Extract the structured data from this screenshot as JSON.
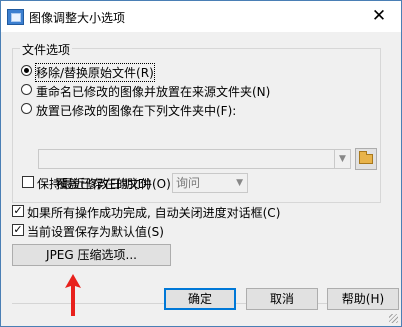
{
  "window": {
    "title": "图像调整大小选项",
    "close_glyph": "✕"
  },
  "file_options": {
    "legend": "文件选项",
    "radios": [
      {
        "label": "移除/替换原始文件(R)",
        "checked": true
      },
      {
        "label": "重命名已修改的图像并放置在来源文件夹(N)",
        "checked": false
      },
      {
        "label": "放置已修改的图像在下列文件夹中(F):",
        "checked": false
      }
    ],
    "folder_path_value": "",
    "overwrite_label": "覆盖已存在的文件(O):",
    "overwrite_value": "询问",
    "keep_date": {
      "label": "保持最近修改日期(D)",
      "checked": false
    }
  },
  "auto_close": {
    "label": "如果所有操作成功完成, 自动关闭进度对话框(C)",
    "checked": true
  },
  "save_default": {
    "label": "当前设置保存为默认值(S)",
    "checked": true
  },
  "jpeg_button": "JPEG 压缩选项...",
  "buttons": {
    "ok": "确定",
    "cancel": "取消",
    "help": "帮助(H)"
  },
  "colors": {
    "window_border": "#4a7fb5",
    "focus_blue": "#0078d7",
    "annotation_arrow": "#e8211c"
  },
  "icons": {
    "app": "image-resize-icon",
    "close": "close-icon",
    "browse": "folder-icon",
    "annotation": "red-arrow-icon"
  }
}
